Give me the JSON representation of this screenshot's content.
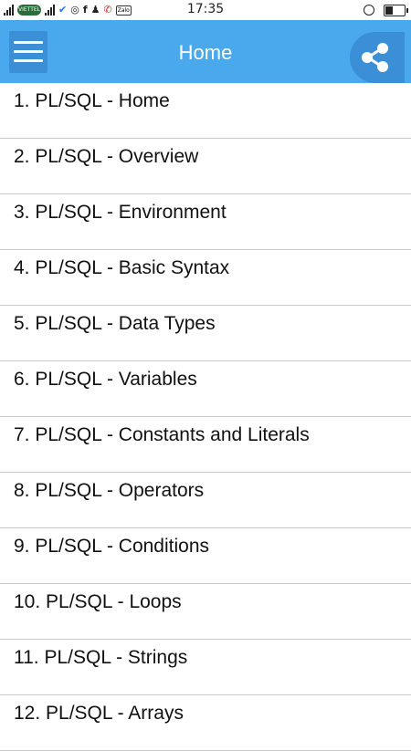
{
  "status_bar": {
    "time": "17:35",
    "carrier_label": "VIETTEL",
    "zalo_label": "Zalo",
    "icons": [
      "signal-icon",
      "carrier-icon",
      "signal-icon",
      "email-verify-icon",
      "instagram-icon",
      "facebook-icon",
      "person-icon",
      "missed-call-icon",
      "zalo-icon",
      "alarm-icon",
      "battery-icon"
    ]
  },
  "app_bar": {
    "title": "Home",
    "menu_icon": "hamburger-menu-icon",
    "share_icon": "share-icon",
    "accent_color": "#4aa8ec"
  },
  "list": {
    "items": [
      {
        "label": "1. PL/SQL - Home"
      },
      {
        "label": "2. PL/SQL - Overview"
      },
      {
        "label": "3. PL/SQL - Environment"
      },
      {
        "label": "4. PL/SQL - Basic Syntax"
      },
      {
        "label": "5. PL/SQL - Data Types"
      },
      {
        "label": "6. PL/SQL - Variables"
      },
      {
        "label": "7. PL/SQL - Constants and Literals"
      },
      {
        "label": "8. PL/SQL - Operators"
      },
      {
        "label": "9. PL/SQL - Conditions"
      },
      {
        "label": "10. PL/SQL - Loops"
      },
      {
        "label": "11. PL/SQL - Strings"
      },
      {
        "label": "12. PL/SQL - Arrays"
      }
    ]
  }
}
